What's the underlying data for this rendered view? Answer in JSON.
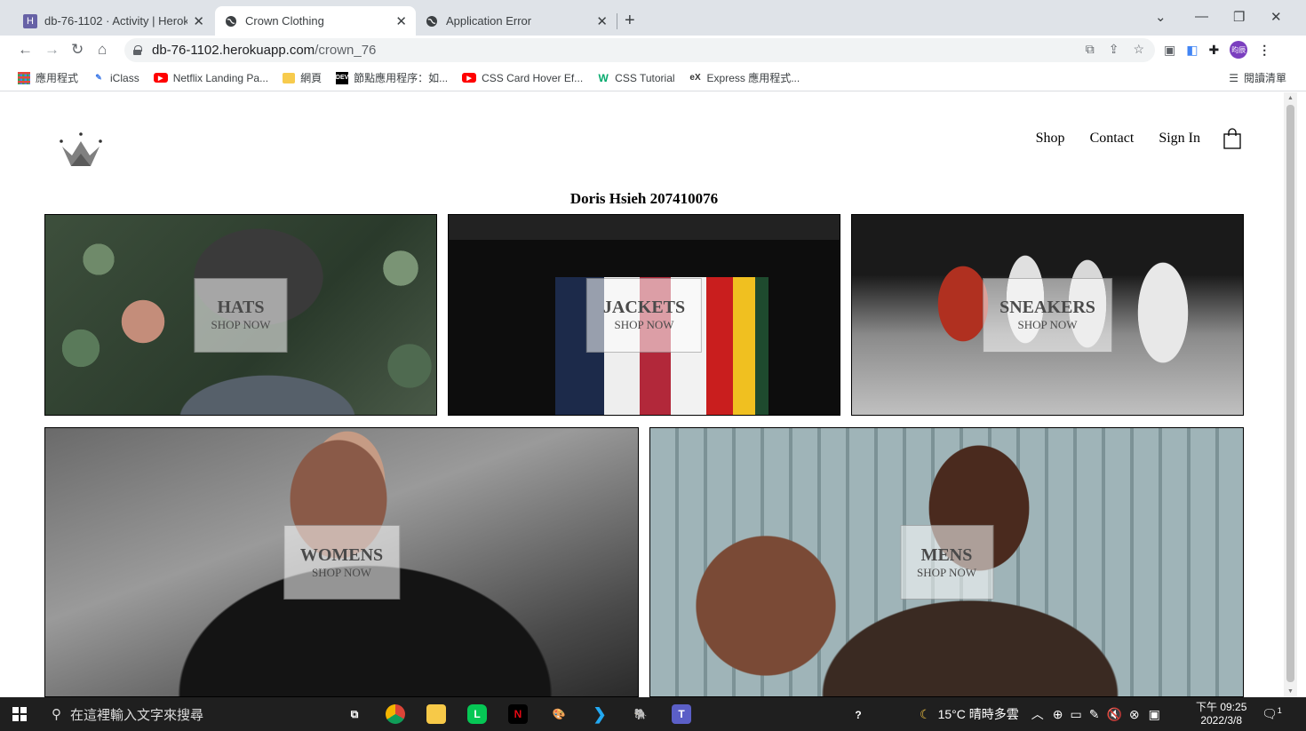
{
  "browser": {
    "tabs": [
      {
        "title": "db-76-1102 · Activity | Heroku",
        "active": false
      },
      {
        "title": "Crown Clothing",
        "active": true
      },
      {
        "title": "Application Error",
        "active": false
      }
    ],
    "url_host": "db-76-1102.herokuapp.com",
    "url_path": "/crown_76",
    "profile_label": "昀辰",
    "bookmarks": [
      {
        "label": "應用程式",
        "icon": "apps-grid-icon"
      },
      {
        "label": "iClass",
        "icon": "iclass-icon"
      },
      {
        "label": "Netflix Landing Pa...",
        "icon": "youtube-icon"
      },
      {
        "label": "網頁",
        "icon": "folder-icon"
      },
      {
        "label": "節點應用程序：如...",
        "icon": "dev-icon"
      },
      {
        "label": "CSS Card Hover Ef...",
        "icon": "youtube-icon"
      },
      {
        "label": "CSS Tutorial",
        "icon": "w3-icon"
      },
      {
        "label": "Express 應用程式...",
        "icon": "express-icon"
      }
    ],
    "reading_list": "閱讀清單"
  },
  "site": {
    "nav": {
      "shop": "Shop",
      "contact": "Contact",
      "sign_in": "Sign In"
    },
    "author": "Doris Hsieh 207410076",
    "categories": [
      {
        "title": "HATS",
        "subtitle": "SHOP NOW"
      },
      {
        "title": "JACKETS",
        "subtitle": "SHOP NOW"
      },
      {
        "title": "SNEAKERS",
        "subtitle": "SHOP NOW"
      },
      {
        "title": "WOMENS",
        "subtitle": "SHOP NOW"
      },
      {
        "title": "MENS",
        "subtitle": "SHOP NOW"
      }
    ]
  },
  "taskbar": {
    "search_placeholder": "在這裡輸入文字來搜尋",
    "weather": "15°C 晴時多雲",
    "time": "下午 09:25",
    "date": "2022/3/8",
    "notification_count": "1"
  }
}
